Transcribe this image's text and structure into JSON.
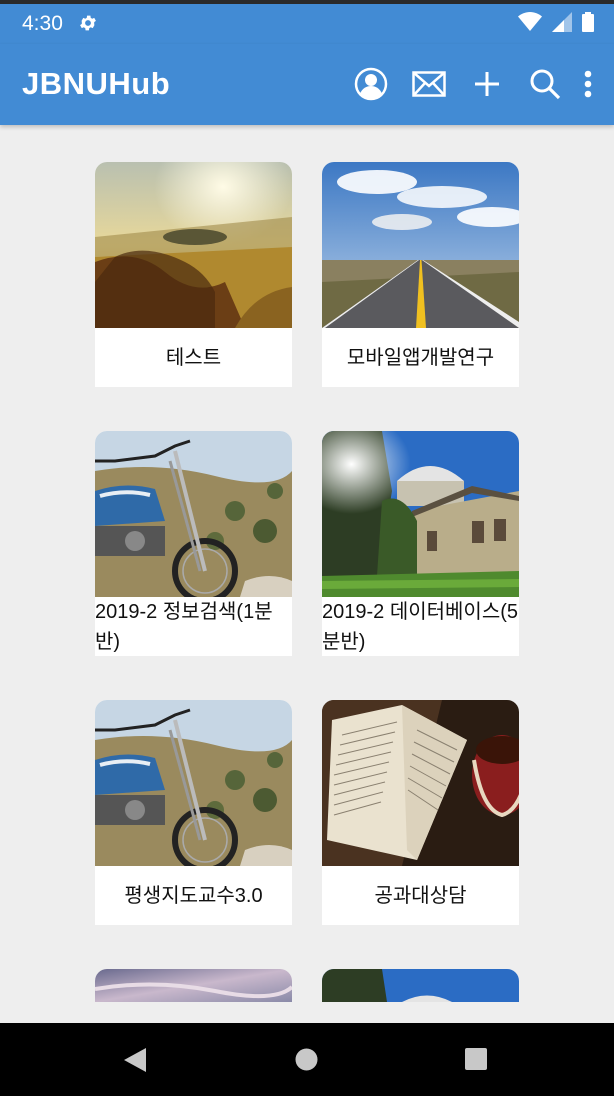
{
  "status": {
    "time": "4:30"
  },
  "appbar": {
    "title": "JBNUHub"
  },
  "cards": [
    {
      "label": "테스트"
    },
    {
      "label": "모바일앱개발연구"
    },
    {
      "label": "2019-2 정보검색(1분반)"
    },
    {
      "label": "2019-2 데이터베이스(5분반)"
    },
    {
      "label": "평생지도교수3.0"
    },
    {
      "label": "공과대상담"
    }
  ],
  "colors": {
    "primary": "#428bd4",
    "background": "#eeeeee"
  },
  "icons": [
    "settings-icon",
    "wifi-icon",
    "signal-icon",
    "battery-icon",
    "profile-icon",
    "mail-icon",
    "add-icon",
    "search-icon",
    "more-vert-icon",
    "back-icon",
    "home-icon",
    "recents-icon"
  ]
}
